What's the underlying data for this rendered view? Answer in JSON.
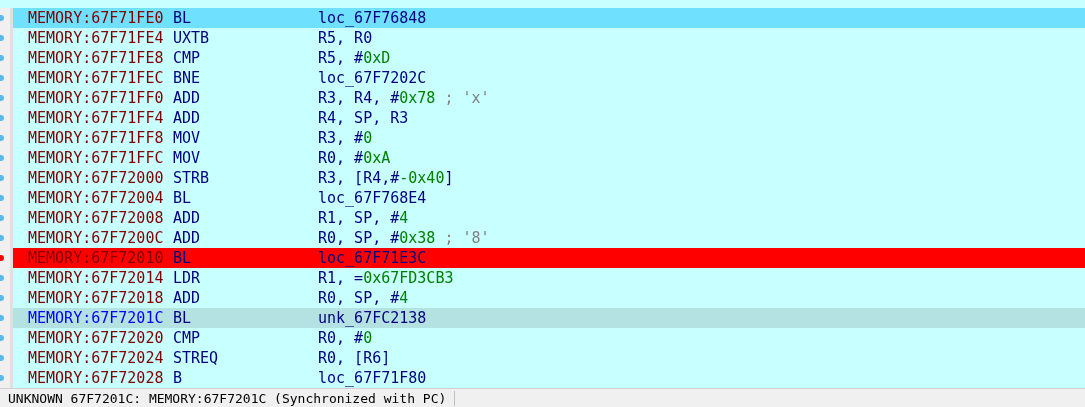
{
  "listing": [
    {
      "address": "MEMORY:67F71FE0",
      "mnemonic": "BL",
      "operands": [
        {
          "kind": "text",
          "text": "loc_67F76848"
        }
      ],
      "selected": true,
      "breakpoint": false,
      "current_pc": false
    },
    {
      "address": "MEMORY:67F71FE4",
      "mnemonic": "UXTB",
      "operands": [
        {
          "kind": "text",
          "text": "R5, R0"
        }
      ],
      "selected": false,
      "breakpoint": false,
      "current_pc": false
    },
    {
      "address": "MEMORY:67F71FE8",
      "mnemonic": "CMP",
      "operands": [
        {
          "kind": "text",
          "text": "R5, #"
        },
        {
          "kind": "number",
          "text": "0xD"
        }
      ],
      "selected": false,
      "breakpoint": false,
      "current_pc": false
    },
    {
      "address": "MEMORY:67F71FEC",
      "mnemonic": "BNE",
      "operands": [
        {
          "kind": "text",
          "text": "loc_67F7202C"
        }
      ],
      "selected": false,
      "breakpoint": false,
      "current_pc": false
    },
    {
      "address": "MEMORY:67F71FF0",
      "mnemonic": "ADD",
      "operands": [
        {
          "kind": "text",
          "text": "R3, R4, #"
        },
        {
          "kind": "number",
          "text": "0x78"
        },
        {
          "kind": "comment",
          "text": " ; 'x'"
        }
      ],
      "selected": false,
      "breakpoint": false,
      "current_pc": false
    },
    {
      "address": "MEMORY:67F71FF4",
      "mnemonic": "ADD",
      "operands": [
        {
          "kind": "text",
          "text": "R4, SP, R3"
        }
      ],
      "selected": false,
      "breakpoint": false,
      "current_pc": false
    },
    {
      "address": "MEMORY:67F71FF8",
      "mnemonic": "MOV",
      "operands": [
        {
          "kind": "text",
          "text": "R3, #"
        },
        {
          "kind": "number",
          "text": "0"
        }
      ],
      "selected": false,
      "breakpoint": false,
      "current_pc": false
    },
    {
      "address": "MEMORY:67F71FFC",
      "mnemonic": "MOV",
      "operands": [
        {
          "kind": "text",
          "text": "R0, #"
        },
        {
          "kind": "number",
          "text": "0xA"
        }
      ],
      "selected": false,
      "breakpoint": false,
      "current_pc": false
    },
    {
      "address": "MEMORY:67F72000",
      "mnemonic": "STRB",
      "operands": [
        {
          "kind": "text",
          "text": "R3, [R4,#"
        },
        {
          "kind": "number",
          "text": "-0x40"
        },
        {
          "kind": "text",
          "text": "]"
        }
      ],
      "selected": false,
      "breakpoint": false,
      "current_pc": false
    },
    {
      "address": "MEMORY:67F72004",
      "mnemonic": "BL",
      "operands": [
        {
          "kind": "text",
          "text": "loc_67F768E4"
        }
      ],
      "selected": false,
      "breakpoint": false,
      "current_pc": false
    },
    {
      "address": "MEMORY:67F72008",
      "mnemonic": "ADD",
      "operands": [
        {
          "kind": "text",
          "text": "R1, SP, #"
        },
        {
          "kind": "number",
          "text": "4"
        }
      ],
      "selected": false,
      "breakpoint": false,
      "current_pc": false
    },
    {
      "address": "MEMORY:67F7200C",
      "mnemonic": "ADD",
      "operands": [
        {
          "kind": "text",
          "text": "R0, SP, #"
        },
        {
          "kind": "number",
          "text": "0x38"
        },
        {
          "kind": "comment",
          "text": " ; '8'"
        }
      ],
      "selected": false,
      "breakpoint": false,
      "current_pc": false
    },
    {
      "address": "MEMORY:67F72010",
      "mnemonic": "BL",
      "operands": [
        {
          "kind": "text",
          "text": "loc_67F71E3C"
        }
      ],
      "selected": false,
      "breakpoint": true,
      "current_pc": false
    },
    {
      "address": "MEMORY:67F72014",
      "mnemonic": "LDR",
      "operands": [
        {
          "kind": "text",
          "text": "R1, ="
        },
        {
          "kind": "number",
          "text": "0x67FD3CB3"
        }
      ],
      "selected": false,
      "breakpoint": false,
      "current_pc": false
    },
    {
      "address": "MEMORY:67F72018",
      "mnemonic": "ADD",
      "operands": [
        {
          "kind": "text",
          "text": "R0, SP, #"
        },
        {
          "kind": "number",
          "text": "4"
        }
      ],
      "selected": false,
      "breakpoint": false,
      "current_pc": false
    },
    {
      "address": "MEMORY:67F7201C",
      "mnemonic": "BL",
      "operands": [
        {
          "kind": "text",
          "text": "unk_67FC2138"
        }
      ],
      "selected": false,
      "breakpoint": false,
      "current_pc": true
    },
    {
      "address": "MEMORY:67F72020",
      "mnemonic": "CMP",
      "operands": [
        {
          "kind": "text",
          "text": "R0, #"
        },
        {
          "kind": "number",
          "text": "0"
        }
      ],
      "selected": false,
      "breakpoint": false,
      "current_pc": false
    },
    {
      "address": "MEMORY:67F72024",
      "mnemonic": "STREQ",
      "operands": [
        {
          "kind": "text",
          "text": "R0, [R6]"
        }
      ],
      "selected": false,
      "breakpoint": false,
      "current_pc": false
    },
    {
      "address": "MEMORY:67F72028",
      "mnemonic": "B",
      "operands": [
        {
          "kind": "text",
          "text": "loc_67F71F80"
        }
      ],
      "selected": false,
      "breakpoint": false,
      "current_pc": false
    }
  ],
  "status_bar": [
    "UNKNOWN 67F7201C: MEMORY:67F7201C (Synchronized with PC)"
  ]
}
